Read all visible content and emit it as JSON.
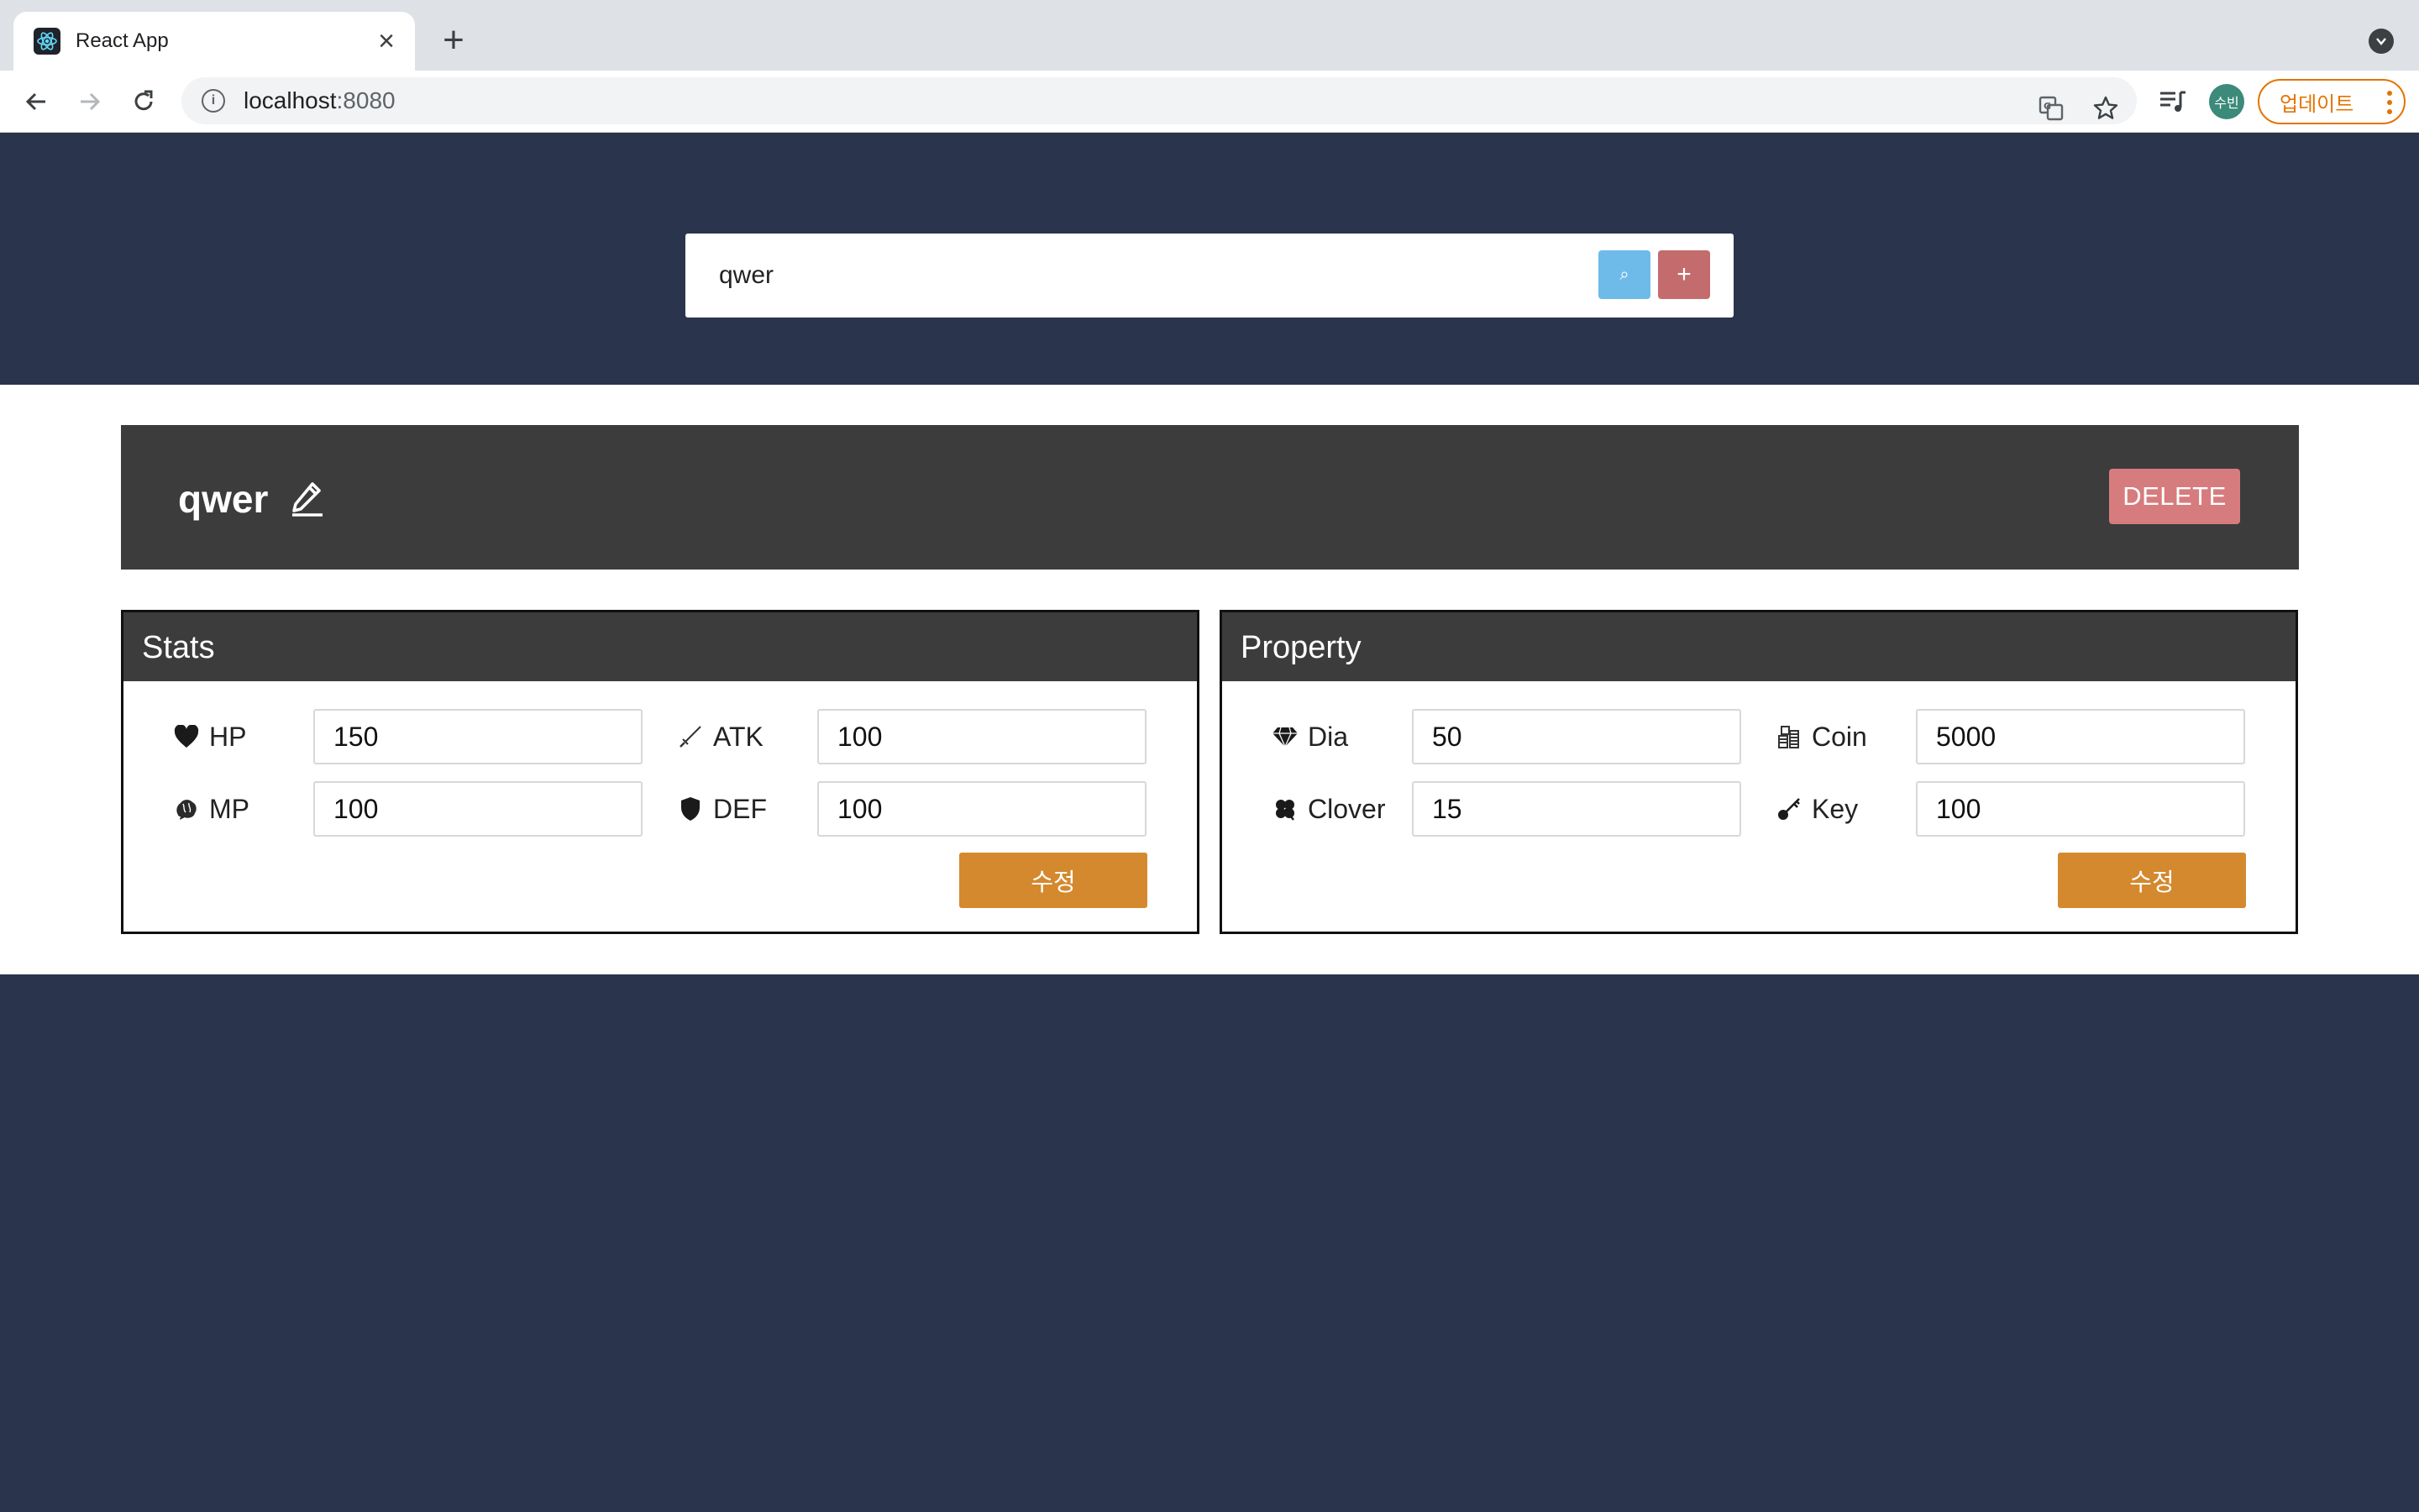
{
  "browser": {
    "tab_title": "React App",
    "tab_close": "×",
    "new_tab": "+",
    "url_host": "localhost",
    "url_port": ":8080",
    "profile_initials": "수빈",
    "update_label": "업데이트",
    "accent_color": "#e37400"
  },
  "search": {
    "value": "qwer",
    "search_button": "⌕",
    "add_button": "+",
    "search_button_color": "#6ebbea",
    "add_button_color": "#c46b6d"
  },
  "character": {
    "name": "qwer",
    "delete_label": "DELETE",
    "delete_color": "#d77c7e"
  },
  "stats": {
    "title": "Stats",
    "fields": [
      {
        "icon": "heart-icon",
        "label": "HP",
        "value": "150"
      },
      {
        "icon": "sword-icon",
        "label": "ATK",
        "value": "100"
      },
      {
        "icon": "brain-icon",
        "label": "MP",
        "value": "100"
      },
      {
        "icon": "shield-icon",
        "label": "DEF",
        "value": "100"
      }
    ],
    "save_label": "수정"
  },
  "property": {
    "title": "Property",
    "fields": [
      {
        "icon": "diamond-icon",
        "label": "Dia",
        "value": "50"
      },
      {
        "icon": "coins-icon",
        "label": "Coin",
        "value": "5000"
      },
      {
        "icon": "clover-icon",
        "label": "Clover",
        "value": "15"
      },
      {
        "icon": "key-icon",
        "label": "Key",
        "value": "100"
      }
    ],
    "save_label": "수정"
  },
  "colors": {
    "page_background": "#2a344c",
    "header_dark": "#3c3c3c",
    "save_button": "#d4892e"
  }
}
